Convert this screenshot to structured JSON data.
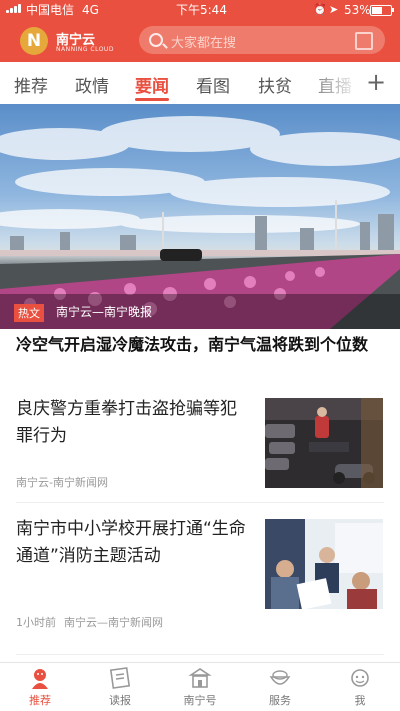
{
  "status": {
    "carrier": "中国电信",
    "network": "4G",
    "time": "下午5:44",
    "battery": "53%"
  },
  "header": {
    "logo_mark": "N",
    "app_name": "南宁云",
    "app_name_en": "NANNING CLOUD",
    "search_placeholder": "大家都在搜"
  },
  "tabs": [
    "推荐",
    "政情",
    "要闻",
    "看图",
    "扶贫",
    "直播"
  ],
  "active_tab": "要闻",
  "hero": {
    "badge": "热文",
    "source": "南宁云—南宁晚报",
    "headline": "冷空气开启湿冷魔法攻击，南宁气温将跌到个位数"
  },
  "news": [
    {
      "title": "良庆警方重拳打击盗抢骗等犯罪行为",
      "time": "",
      "source": "南宁云-南宁新闻网"
    },
    {
      "title": "南宁市中小学校开展打通“生命通道”消防主题活动",
      "time": "1小时前",
      "source": "南宁云—南宁新闻网"
    }
  ],
  "tabbar": [
    {
      "label": "推荐",
      "icon": "tiger-icon",
      "active": true
    },
    {
      "label": "读报",
      "icon": "newspaper-icon",
      "active": false
    },
    {
      "label": "南宁号",
      "icon": "building-icon",
      "active": false
    },
    {
      "label": "服务",
      "icon": "service-bowl-icon",
      "active": false
    },
    {
      "label": "我",
      "icon": "profile-icon",
      "active": false
    }
  ],
  "colors": {
    "brand": "#e9503f",
    "logo": "#e6a83a"
  }
}
